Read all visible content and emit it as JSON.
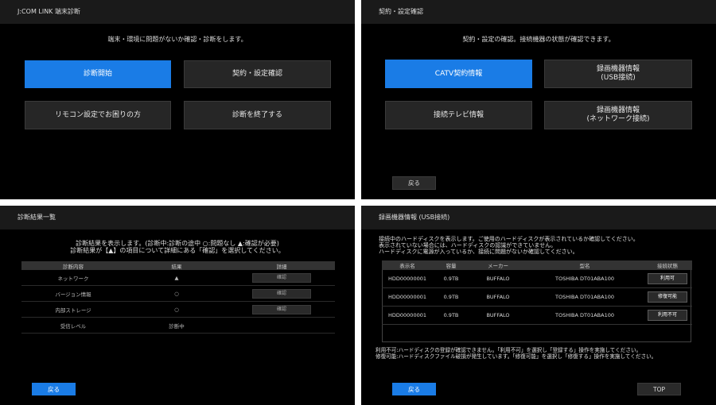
{
  "p1": {
    "title": "J:COM LINK 端末診断",
    "subtitle": "端末・環境に問題がないか確認・診断をします。",
    "buttons": [
      "診断開始",
      "契約・設定確認",
      "リモコン設定でお困りの方",
      "診断を終了する"
    ]
  },
  "p2": {
    "title": "契約・設定確認",
    "subtitle": "契約・設定の確認。接続機器の状態が確認できます。",
    "buttons": [
      "CATV契約情報",
      "録画機器情報\n(USB接続)",
      "接続テレビ情報",
      "録画機器情報\n(ネットワーク接続)"
    ],
    "back": "戻る"
  },
  "p3": {
    "title": "診断結果一覧",
    "desc1": "診断結果を表示します。(診断中:診断の途中  ○:問題なし  ▲:確認が必要)",
    "desc2": "診断結果が【▲】の項目について詳細にある「確認」を選択してください。",
    "headers": [
      "診断内容",
      "結果",
      "詳細"
    ],
    "rows": [
      {
        "item": "ネットワーク",
        "result": "▲",
        "detail": "確認"
      },
      {
        "item": "バージョン情報",
        "result": "○",
        "detail": "確認"
      },
      {
        "item": "内部ストレージ",
        "result": "○",
        "detail": "確認"
      },
      {
        "item": "受信レベル",
        "result": "診断中",
        "detail": ""
      }
    ],
    "back": "戻る"
  },
  "p4": {
    "title": "録画機器情報 (USB接続)",
    "desc": "接続中のハードディスクを表示します。ご使用のハードディスクが表示されているか確認してください。\n表示されていない場合には、ハードディスクの認識ができていません。\nハードディスクに電源が入っているか、接続に問題がないか確認してください。",
    "headers": [
      "表示名",
      "容量",
      "メーカー",
      "型名",
      "接続状態"
    ],
    "rows": [
      {
        "name": "HDD00000001",
        "size": "0.9TB",
        "maker": "BUFFALO",
        "model": "TOSHIBA DT01ABA100",
        "status": "利用可"
      },
      {
        "name": "HDD00000001",
        "size": "0.9TB",
        "maker": "BUFFALO",
        "model": "TOSHIBA DT01ABA100",
        "status": "修復可能"
      },
      {
        "name": "HDD00000001",
        "size": "0.9TB",
        "maker": "BUFFALO",
        "model": "TOSHIBA DT01ABA100",
        "status": "利用不可"
      }
    ],
    "note": "利用不可:ハードディスクの登録が確認できません。「利用不可」を選択し「登録する」操作を実施してください。\n修復可能:ハードディスクファイル破損が発生しています。「修復可能」を選択し「修復する」操作を実施してください。",
    "back": "戻る",
    "top": "TOP"
  }
}
